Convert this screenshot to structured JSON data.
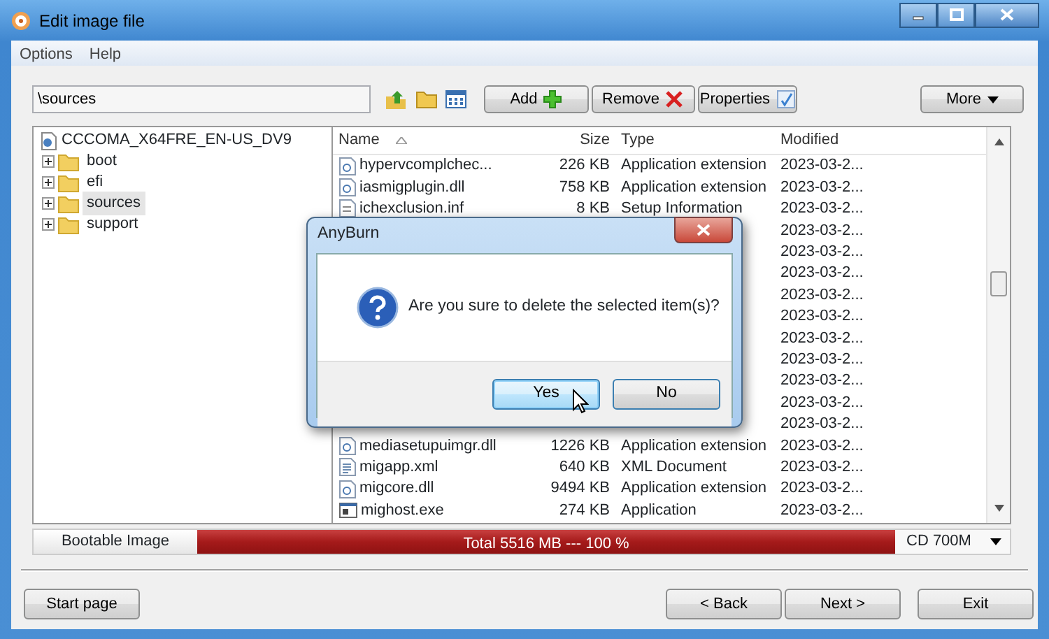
{
  "window": {
    "title": "Edit image file"
  },
  "menu": [
    {
      "label": "Options"
    },
    {
      "label": "Help"
    }
  ],
  "path_field": {
    "value": "\\sources"
  },
  "toolbar_buttons": [
    {
      "label": "Add",
      "kind": "add"
    },
    {
      "label": "Remove",
      "kind": "remove"
    },
    {
      "label": "Properties",
      "kind": "properties"
    }
  ],
  "more_button": {
    "label": "More"
  },
  "tree": {
    "label": "CCCOMA_X64FRE_EN-US_DV9",
    "children": [
      {
        "label": "boot",
        "expanded": false,
        "selected": false
      },
      {
        "label": "efi",
        "expanded": false,
        "selected": false
      },
      {
        "label": "sources",
        "expanded": false,
        "selected": true
      },
      {
        "label": "support",
        "expanded": false,
        "selected": false
      }
    ]
  },
  "table": {
    "columns": [
      "Name",
      "Size",
      "Type",
      "Modified"
    ],
    "rows": [
      {
        "kind": "dll",
        "name": "hypervcomplchec...",
        "size": "226 KB",
        "type": "Application extension",
        "modified": "2023-03-2..."
      },
      {
        "kind": "dll",
        "name": "iasmigplugin.dll",
        "size": "758 KB",
        "type": "Application extension",
        "modified": "2023-03-2..."
      },
      {
        "kind": "inf",
        "name": "ichexclusion.inf",
        "size": "8 KB",
        "type": "Setup Information",
        "modified": "2023-03-2..."
      },
      {
        "modified": "2023-03-2..."
      },
      {
        "modified": "2023-03-2..."
      },
      {
        "modified": "2023-03-2..."
      },
      {
        "modified": "2023-03-2..."
      },
      {
        "modified": "2023-03-2..."
      },
      {
        "modified": "2023-03-2..."
      },
      {
        "modified": "2023-03-2..."
      },
      {
        "modified": "2023-03-2..."
      },
      {
        "modified": "2023-03-2..."
      },
      {
        "modified": "2023-03-2..."
      },
      {
        "kind": "dll",
        "name": "mediasetupuimgr.dll",
        "size": "1226 KB",
        "type": "Application extension",
        "modified": "2023-03-2..."
      },
      {
        "kind": "xml",
        "name": "migapp.xml",
        "size": "640 KB",
        "type": "XML Document",
        "modified": "2023-03-2..."
      },
      {
        "kind": "dll",
        "name": "migcore.dll",
        "size": "9494 KB",
        "type": "Application extension",
        "modified": "2023-03-2..."
      },
      {
        "kind": "exe",
        "name": "mighost.exe",
        "size": "274 KB",
        "type": "Application",
        "modified": "2023-03-2..."
      }
    ]
  },
  "status": {
    "image_type": "Bootable Image",
    "usage_text": "Total  5516 MB  ---  100 %",
    "level": 1.0,
    "media": "CD 700M"
  },
  "footer_buttons": [
    {
      "label": "Start page",
      "kind": "left"
    },
    {
      "label": "< Back",
      "kind": "right"
    },
    {
      "label": "Next >",
      "kind": "right"
    },
    {
      "label": "Exit",
      "kind": "exit"
    }
  ],
  "dialog": {
    "title": "AnyBurn",
    "message": "Are you sure to delete the selected item(s)?",
    "buttons": [
      {
        "label": "Yes",
        "selected": true
      },
      {
        "label": "No",
        "selected": false
      }
    ]
  }
}
